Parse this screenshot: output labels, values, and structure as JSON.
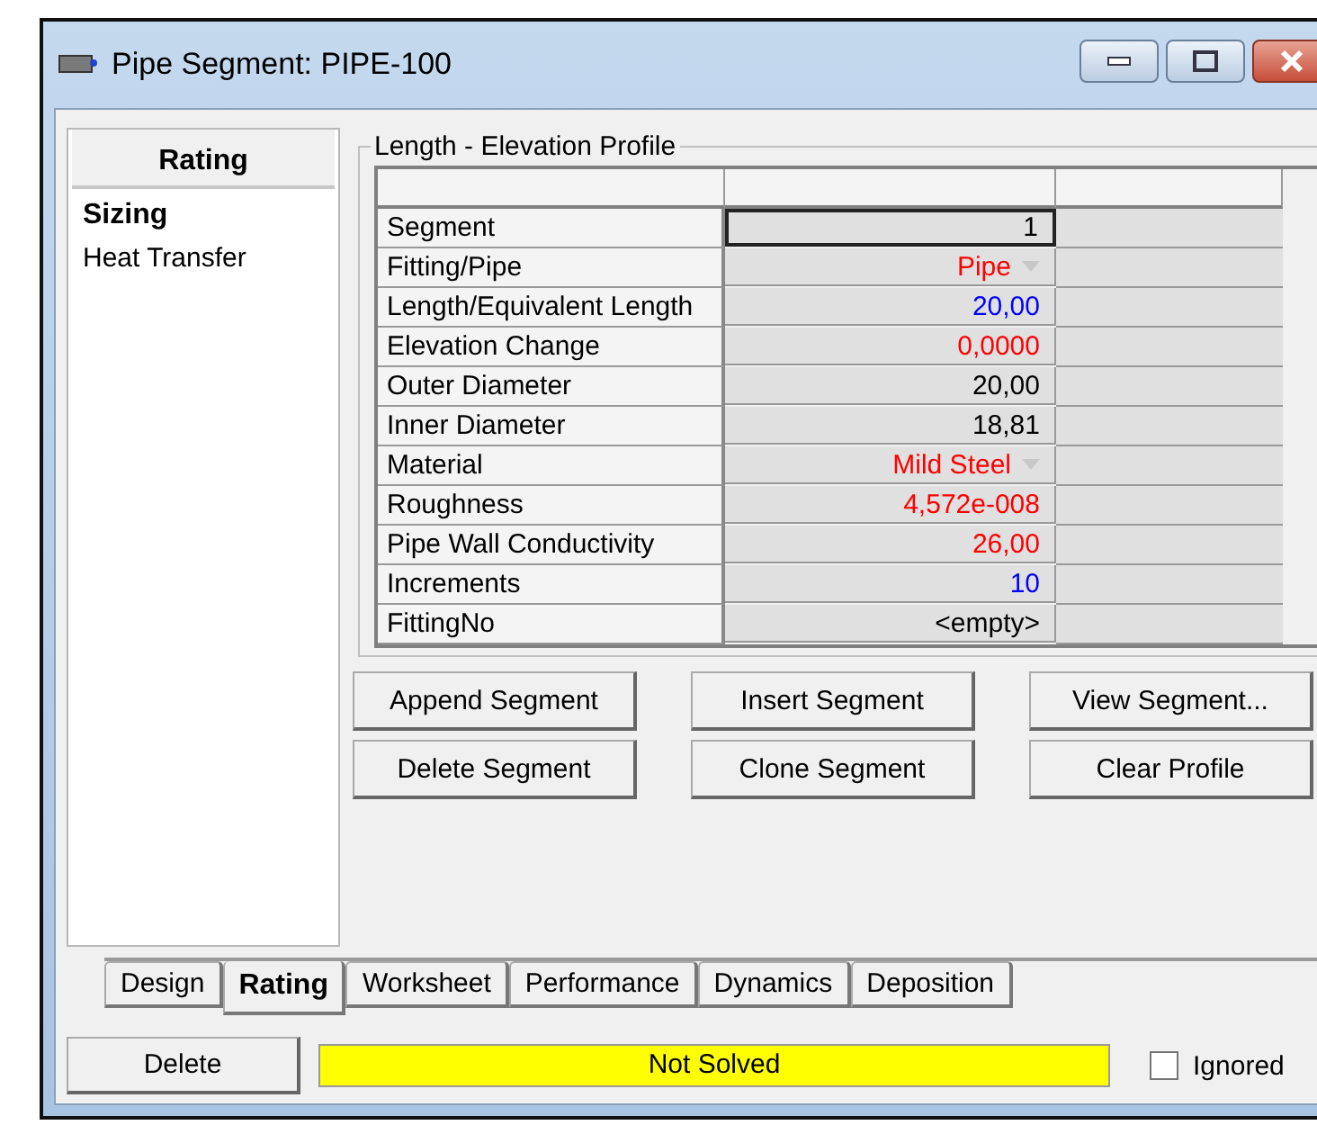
{
  "window": {
    "title": "Pipe Segment: PIPE-100"
  },
  "sidebar": {
    "header": "Rating",
    "items": [
      {
        "label": "Sizing",
        "selected": true
      },
      {
        "label": "Heat Transfer",
        "selected": false
      }
    ]
  },
  "profile": {
    "title": "Length - Elevation Profile",
    "rows": [
      {
        "label": "Segment",
        "value": "1",
        "kind": "text",
        "color": "#000000",
        "selected": true
      },
      {
        "label": "Fitting/Pipe",
        "value": "Pipe",
        "kind": "dropdown",
        "color": "#ff0000",
        "selected": false
      },
      {
        "label": "Length/Equivalent Length",
        "value": "20,00",
        "kind": "text",
        "color": "#0000ff",
        "selected": false
      },
      {
        "label": "Elevation Change",
        "value": "0,0000",
        "kind": "text",
        "color": "#ff0000",
        "selected": false
      },
      {
        "label": "Outer Diameter",
        "value": "20,00",
        "kind": "text",
        "color": "#000000",
        "selected": false
      },
      {
        "label": "Inner Diameter",
        "value": "18,81",
        "kind": "text",
        "color": "#000000",
        "selected": false
      },
      {
        "label": "Material",
        "value": "Mild Steel",
        "kind": "dropdown",
        "color": "#ff0000",
        "selected": false
      },
      {
        "label": "Roughness",
        "value": "4,572e-008",
        "kind": "text",
        "color": "#ff0000",
        "selected": false
      },
      {
        "label": "Pipe Wall Conductivity",
        "value": "26,00",
        "kind": "text",
        "color": "#ff0000",
        "selected": false
      },
      {
        "label": "Increments",
        "value": "10",
        "kind": "text",
        "color": "#0000ff",
        "selected": false
      },
      {
        "label": "FittingNo",
        "value": "<empty>",
        "kind": "text",
        "color": "#000000",
        "selected": false
      }
    ]
  },
  "buttons": [
    "Append Segment",
    "Insert Segment",
    "View Segment...",
    "Delete Segment",
    "Clone Segment",
    "Clear Profile"
  ],
  "tabs": [
    {
      "label": "Design",
      "selected": false
    },
    {
      "label": "Rating",
      "selected": true
    },
    {
      "label": "Worksheet",
      "selected": false
    },
    {
      "label": "Performance",
      "selected": false
    },
    {
      "label": "Dynamics",
      "selected": false
    },
    {
      "label": "Deposition",
      "selected": false
    }
  ],
  "footer": {
    "delete_button": "Delete",
    "status": "Not Solved",
    "ignored": {
      "label": "Ignored",
      "checked": false
    }
  }
}
